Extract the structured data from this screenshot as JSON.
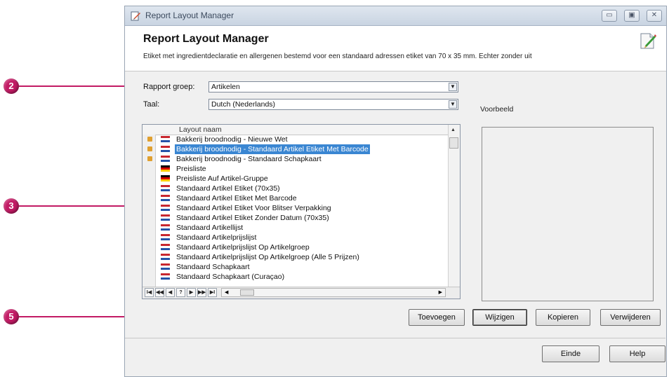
{
  "window": {
    "title": "Report Layout Manager",
    "controls": {
      "minimize": "▭",
      "maximize": "▣",
      "close": "✕"
    }
  },
  "header": {
    "title": "Report Layout Manager",
    "description": "Etiket met ingredientdeclaratie en allergenen bestemd voor een standaard adressen etiket van 70 x 35 mm. Echter zonder uit",
    "icon": "edit-document-icon"
  },
  "form": {
    "rapport_groep_label": "Rapport groep:",
    "rapport_groep_value": "Artikelen",
    "taal_label": "Taal:",
    "taal_value": "Dutch (Nederlands)",
    "voorbeeld_label": "Voorbeeld"
  },
  "grid": {
    "column_header": "Layout naam",
    "rows": [
      {
        "label": "Bakkerij broodnodig - Nieuwe Wet",
        "flag": "nl",
        "locked": true,
        "selected": false
      },
      {
        "label": "Bakkerij broodnodig - Standaard Artikel Etiket Met Barcode",
        "flag": "nl",
        "locked": true,
        "selected": true
      },
      {
        "label": "Bakkerij broodnodig - Standaard Schapkaart",
        "flag": "nl",
        "locked": true,
        "selected": false
      },
      {
        "label": "Preisliste",
        "flag": "de",
        "locked": false,
        "selected": false
      },
      {
        "label": "Preisliste Auf Artikel-Gruppe",
        "flag": "de",
        "locked": false,
        "selected": false
      },
      {
        "label": "Standaard Artikel Etiket (70x35)",
        "flag": "nl",
        "locked": false,
        "selected": false
      },
      {
        "label": "Standaard Artikel Etiket Met Barcode",
        "flag": "nl",
        "locked": false,
        "selected": false
      },
      {
        "label": "Standaard Artikel Etiket Voor Blitser Verpakking",
        "flag": "nl",
        "locked": false,
        "selected": false
      },
      {
        "label": "Standaard Artikel Etiket Zonder Datum (70x35)",
        "flag": "nl",
        "locked": false,
        "selected": false
      },
      {
        "label": "Standaard Artikellijst",
        "flag": "nl",
        "locked": false,
        "selected": false
      },
      {
        "label": "Standaard Artikelprijslijst",
        "flag": "nl",
        "locked": false,
        "selected": false
      },
      {
        "label": "Standaard Artikelprijslijst Op Artikelgroep",
        "flag": "nl",
        "locked": false,
        "selected": false
      },
      {
        "label": "Standaard Artikelprijslijst Op Artikelgroep (Alle 5 Prijzen)",
        "flag": "nl",
        "locked": false,
        "selected": false
      },
      {
        "label": "Standaard Schapkaart",
        "flag": "nl",
        "locked": false,
        "selected": false
      },
      {
        "label": "Standaard Schapkaart (Curaçao)",
        "flag": "nl",
        "locked": false,
        "selected": false
      }
    ],
    "nav_buttons": [
      "I◀",
      "◀◀",
      "◀",
      "?",
      "▶",
      "▶▶",
      "▶I"
    ]
  },
  "buttons": {
    "toevoegen": "Toevoegen",
    "wijzigen": "Wijzigen",
    "kopieren": "Kopieren",
    "verwijderen": "Verwijderen",
    "einde": "Einde",
    "help": "Help"
  },
  "callouts": [
    "2",
    "3",
    "5"
  ],
  "colors": {
    "callout": "#c21a64",
    "selection": "#3a86d2"
  }
}
